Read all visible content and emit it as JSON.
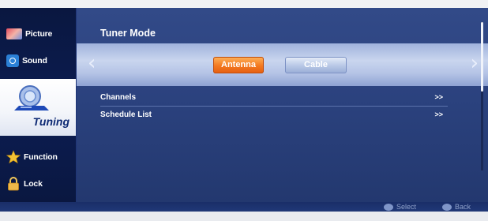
{
  "sidebar": {
    "items": [
      {
        "label": "Picture",
        "icon": "picture-icon"
      },
      {
        "label": "Sound",
        "icon": "sound-icon"
      },
      {
        "label": "Tuning",
        "icon": "tuning-icon",
        "selected": true
      },
      {
        "label": "Function",
        "icon": "star-icon"
      },
      {
        "label": "Lock",
        "icon": "lock-icon"
      }
    ]
  },
  "main": {
    "title": "Tuner Mode",
    "modes": [
      {
        "label": "Antenna",
        "selected": true
      },
      {
        "label": "Cable",
        "selected": false
      }
    ],
    "left_arrow": "‹",
    "right_arrow": "›",
    "rows": [
      {
        "label": "Channels",
        "chevron": ">>"
      },
      {
        "label": "Schedule List",
        "chevron": ">>"
      }
    ]
  },
  "footer": {
    "select_label": "Select",
    "back_label": "Back"
  },
  "colors": {
    "accent_selected": "#f3781f",
    "panel": "#2c4380",
    "sidebar": "#0c1d52"
  }
}
